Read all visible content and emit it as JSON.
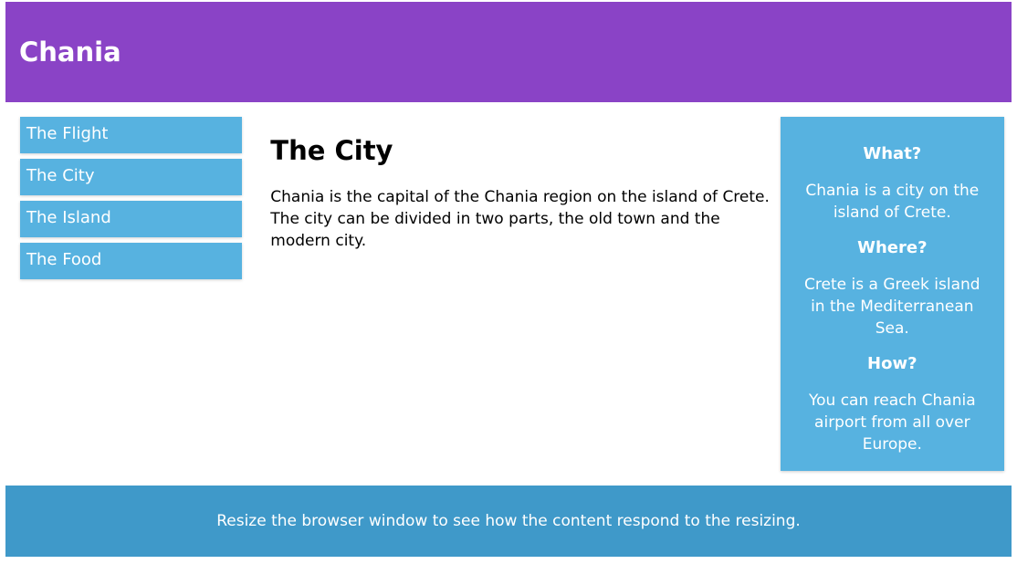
{
  "header": {
    "title": "Chania"
  },
  "menu": {
    "items": [
      {
        "label": "The Flight"
      },
      {
        "label": "The City"
      },
      {
        "label": "The Island"
      },
      {
        "label": "The Food"
      }
    ]
  },
  "main": {
    "heading": "The City",
    "paragraph": "Chania is the capital of the Chania region on the island of Crete. The city can be divided in two parts, the old town and the modern city."
  },
  "aside": {
    "sections": [
      {
        "heading": "What?",
        "text": "Chania is a city on the island of Crete."
      },
      {
        "heading": "Where?",
        "text": "Crete is a Greek island in the Mediterranean Sea."
      },
      {
        "heading": "How?",
        "text": "You can reach Chania airport from all over Europe."
      }
    ]
  },
  "footer": {
    "text": "Resize the browser window to see how the content respond to the resizing."
  },
  "colors": {
    "header_bg": "#8a43c6",
    "menu_bg": "#57b2e0",
    "aside_bg": "#57b2e0",
    "footer_bg": "#3f99c9"
  }
}
